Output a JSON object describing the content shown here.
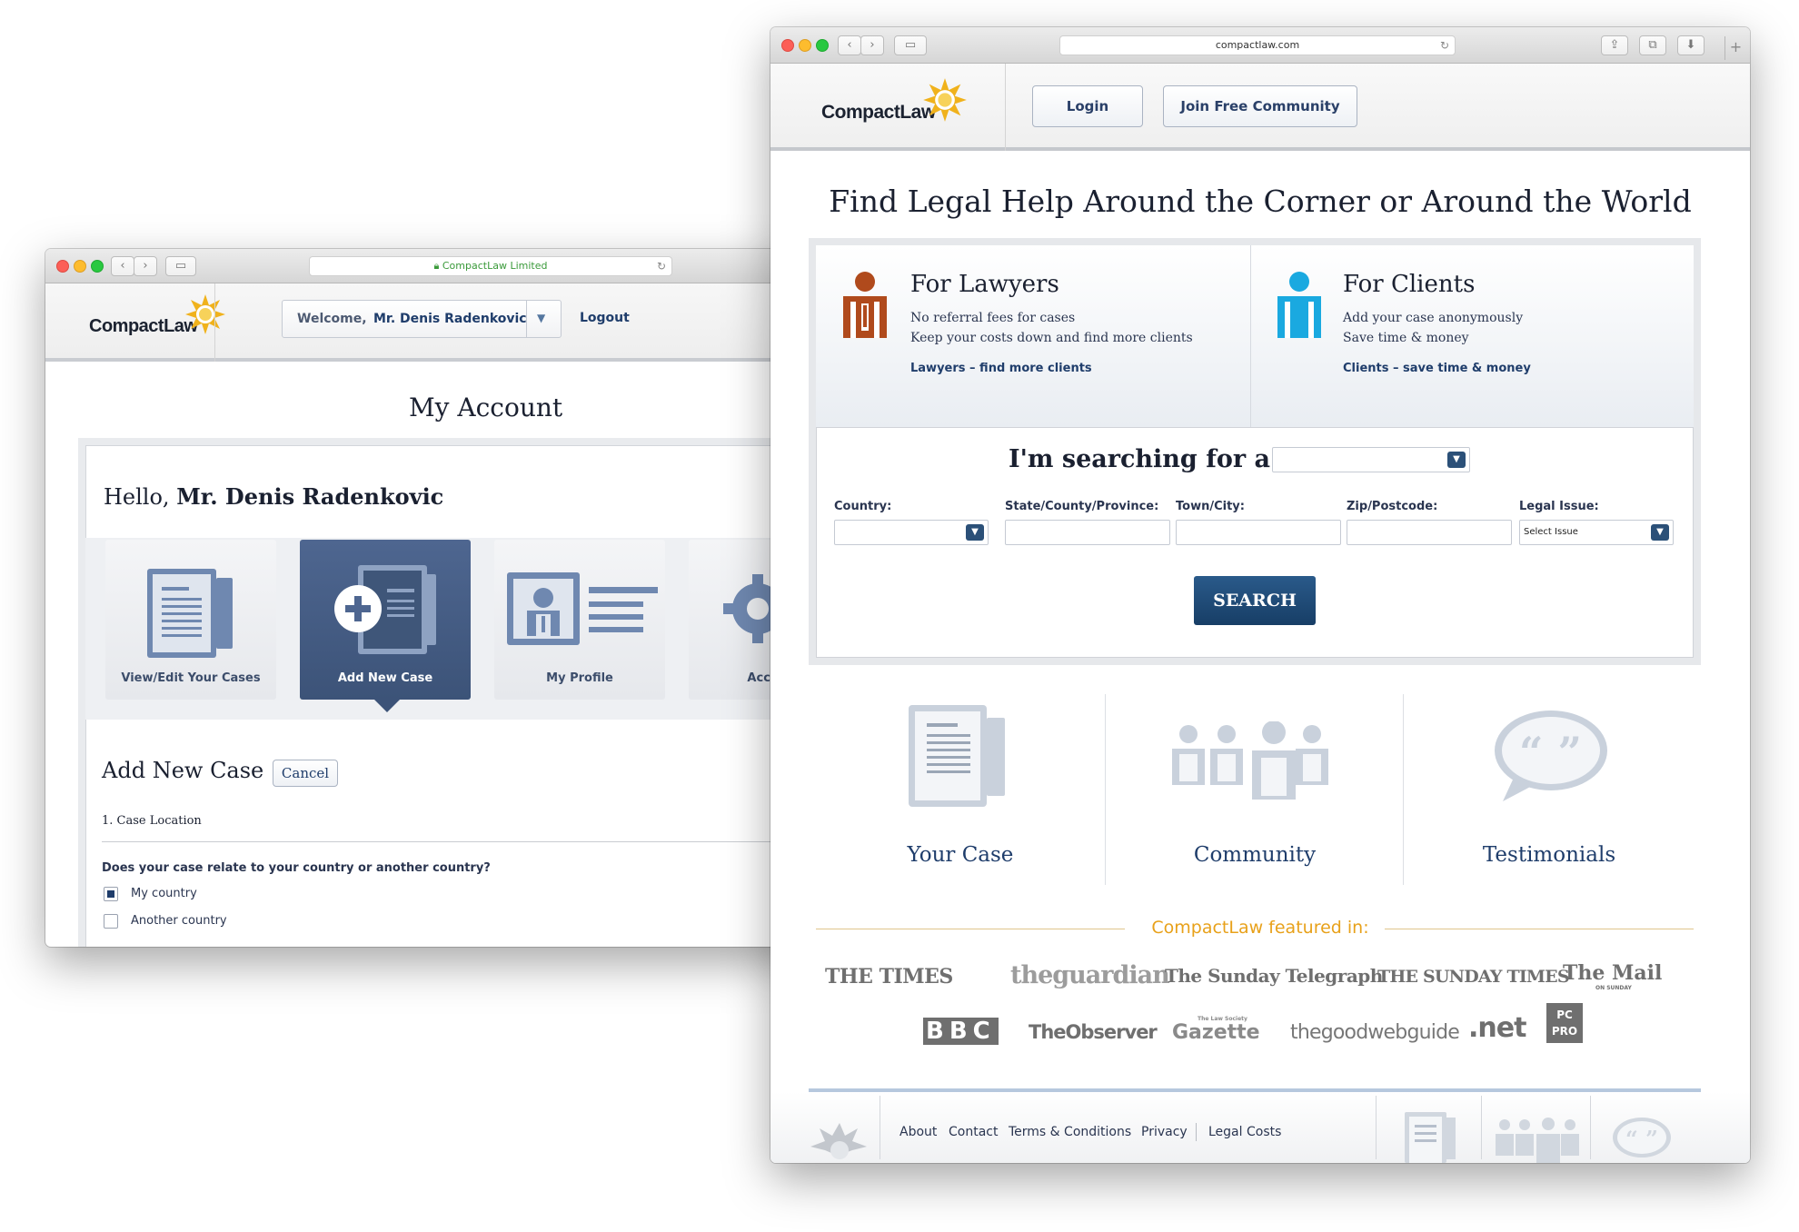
{
  "back_window": {
    "url": "CompactLaw Limited",
    "logo": "CompactLaw",
    "welcome_prefix": "Welcome,",
    "welcome_name": "Mr. Denis Radenkovic",
    "logout": "Logout",
    "page_title": "My Account",
    "greeting_prefix": "Hello,",
    "greeting_name": "Mr. Denis Radenkovic",
    "tiles": [
      {
        "label": "View/Edit Your Cases",
        "active": false
      },
      {
        "label": "Add New Case",
        "active": true
      },
      {
        "label": "My Profile",
        "active": false
      },
      {
        "label": "Account",
        "active": false
      }
    ],
    "section_title": "Add New Case",
    "cancel": "Cancel",
    "step": "1. Case Location",
    "question": "Does your case relate to your country or another country?",
    "options": [
      {
        "label": "My country",
        "checked": true
      },
      {
        "label": "Another country",
        "checked": false
      }
    ]
  },
  "front_window": {
    "url": "compactlaw.com",
    "logo": "CompactLaw",
    "login": "Login",
    "join": "Join Free Community",
    "headline": "Find Legal Help Around the Corner or Around the World",
    "lawyers": {
      "title": "For Lawyers",
      "line1": "No referral fees for cases",
      "line2": "Keep your costs down and find more clients",
      "link": "Lawyers – find more clients",
      "color": "#b04a1c"
    },
    "clients": {
      "title": "For Clients",
      "line1": "Add your case anonymously",
      "line2": "Save time & money",
      "link": "Clients – save time & money",
      "color": "#1aa9e0"
    },
    "search_heading": "I'm searching for a:",
    "fields": {
      "country": "Country:",
      "state": "State/County/Province:",
      "town": "Town/City:",
      "zip": "Zip/Postcode:",
      "issue": "Legal Issue:",
      "issue_value": "Select Issue"
    },
    "search_button": "SEARCH",
    "features": [
      "Your Case",
      "Community",
      "Testimonials"
    ],
    "featured_in": "CompactLaw featured in:",
    "papers_row1": [
      "THE TIMES",
      "theguardian",
      "The Sunday Telegraph",
      "THE SUNDAY TIMES",
      "The Mail"
    ],
    "papers_row1_sub": {
      "mail": "ON SUNDAY"
    },
    "papers_row2": [
      "BBC",
      "TheObserver",
      "Gazette",
      "thegoodwebguide",
      ".net",
      "PC PRO"
    ],
    "papers_row2_sub": {
      "gazette": "The Law Society"
    },
    "footer_links": [
      "About",
      "Contact",
      "Terms & Conditions",
      "Privacy",
      "Legal Costs"
    ],
    "colors": {
      "navy": "#1f3d6b",
      "gold": "#e8a11a",
      "button": "#1d4a73"
    }
  }
}
